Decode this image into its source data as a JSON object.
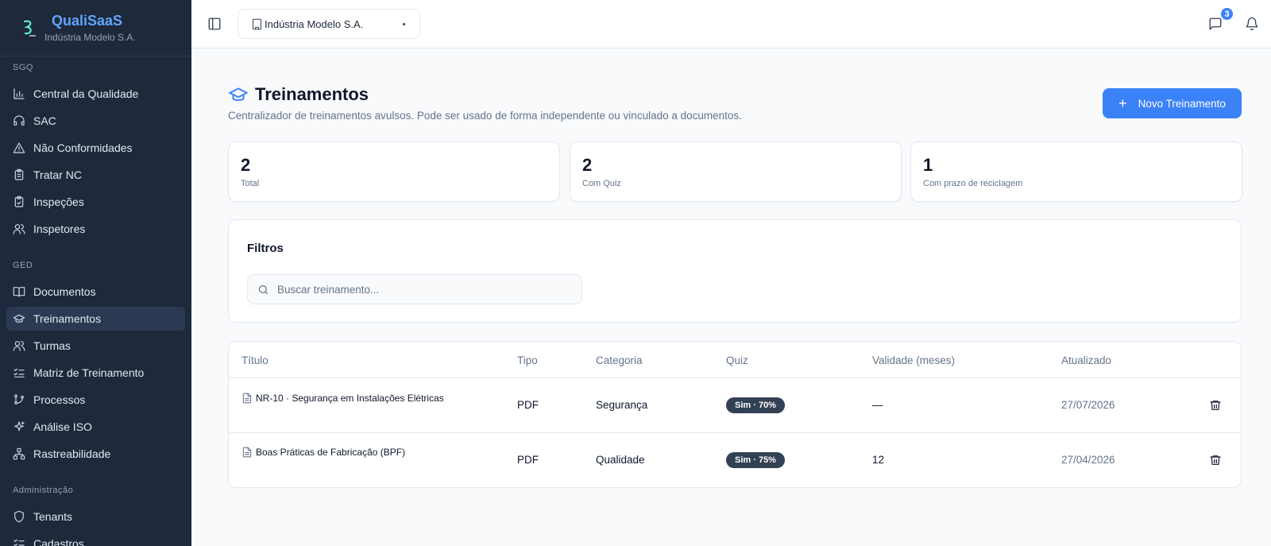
{
  "brand": {
    "name": "QualiSaaS",
    "tenant": "Indústria Modelo S.A."
  },
  "sidebar": {
    "sections": [
      {
        "label": "SGQ",
        "items": [
          {
            "label": "Central da Qualidade",
            "icon": "bar-chart-icon"
          },
          {
            "label": "SAC",
            "icon": "headphones-icon"
          },
          {
            "label": "Não Conformidades",
            "icon": "alert-triangle-icon"
          },
          {
            "label": "Tratar NC",
            "icon": "clipboard-icon"
          },
          {
            "label": "Inspeções",
            "icon": "clipboard-check-icon"
          },
          {
            "label": "Inspetores",
            "icon": "users-icon"
          }
        ]
      },
      {
        "label": "GED",
        "items": [
          {
            "label": "Documentos",
            "icon": "book-open-icon"
          },
          {
            "label": "Treinamentos",
            "icon": "graduation-cap-icon",
            "active": true
          },
          {
            "label": "Turmas",
            "icon": "users-icon"
          },
          {
            "label": "Matriz de Treinamento",
            "icon": "list-checks-icon"
          },
          {
            "label": "Processos",
            "icon": "git-branch-icon"
          },
          {
            "label": "Análise ISO",
            "icon": "sparkles-icon"
          },
          {
            "label": "Rastreabilidade",
            "icon": "network-icon"
          }
        ]
      },
      {
        "label": "Administração",
        "items": [
          {
            "label": "Tenants",
            "icon": "shield-icon"
          },
          {
            "label": "Cadastros",
            "icon": "list-checks-icon"
          }
        ]
      }
    ]
  },
  "topbar": {
    "tenant_select": "Indústria Modelo S.A.",
    "messages_badge": "3"
  },
  "page": {
    "title": "Treinamentos",
    "description": "Centralizador de treinamentos avulsos. Pode ser usado de forma independente ou vinculado a documentos.",
    "new_button": "Novo Treinamento"
  },
  "stats": [
    {
      "value": "2",
      "label": "Total"
    },
    {
      "value": "2",
      "label": "Com Quiz"
    },
    {
      "value": "1",
      "label": "Com prazo de reciclagem"
    }
  ],
  "filters": {
    "title": "Filtros",
    "search_placeholder": "Buscar treinamento..."
  },
  "table": {
    "headers": [
      "Título",
      "Tipo",
      "Categoria",
      "Quiz",
      "Validade (meses)",
      "Atualizado"
    ],
    "rows": [
      {
        "title": "NR-10 · Segurança em Instalações Elétricas",
        "type": "PDF",
        "category": "Segurança",
        "quiz": "Sim · 70%",
        "validity": "—",
        "updated": "27/07/2026"
      },
      {
        "title": "Boas Práticas de Fabricação (BPF)",
        "type": "PDF",
        "category": "Qualidade",
        "quiz": "Sim · 75%",
        "validity": "12",
        "updated": "27/04/2026"
      }
    ]
  },
  "colors": {
    "accent": "#3b82f6",
    "sidebar_bg": "#1e293b",
    "badge_bg": "#334155"
  }
}
